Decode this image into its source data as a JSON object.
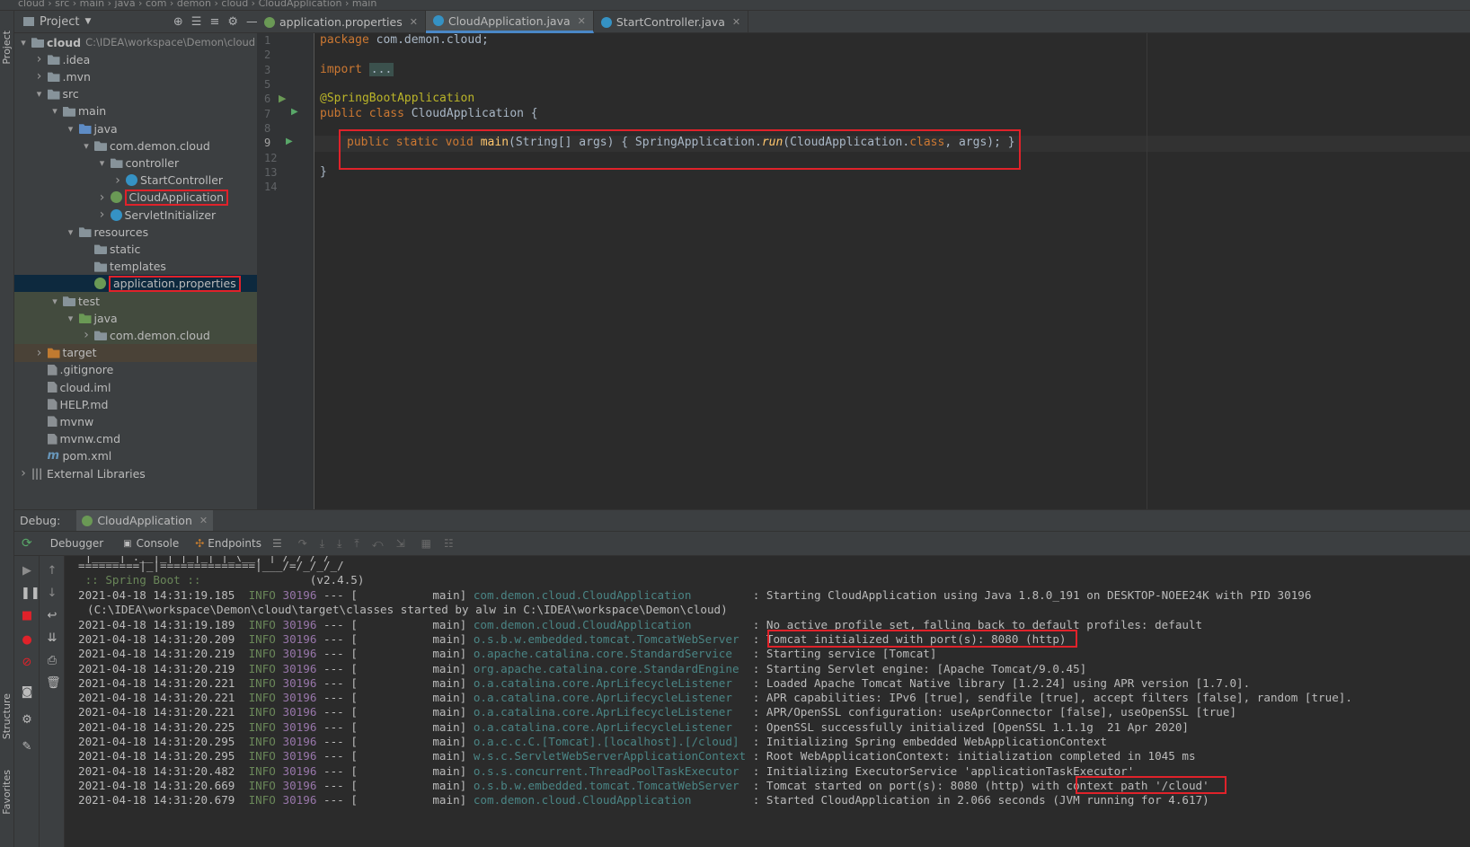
{
  "topbar": {
    "crumb": "cloud › src › main › java › com › demon › cloud › CloudApplication › main"
  },
  "left_stripe": {
    "project": "Project",
    "structure": "Structure",
    "favorites": "Favorites"
  },
  "project_panel": {
    "title": "Project",
    "tree": [
      {
        "label": "cloud",
        "hint": "C:\\IDEA\\workspace\\Demon\\cloud",
        "indent": 0,
        "arrow": "▾",
        "icon": "folder"
      },
      {
        "label": ".idea",
        "indent": 1,
        "arrow": "›",
        "icon": "folder"
      },
      {
        "label": ".mvn",
        "indent": 1,
        "arrow": "›",
        "icon": "folder"
      },
      {
        "label": "src",
        "indent": 1,
        "arrow": "▾",
        "icon": "folder"
      },
      {
        "label": "main",
        "indent": 2,
        "arrow": "▾",
        "icon": "folder"
      },
      {
        "label": "java",
        "indent": 3,
        "arrow": "▾",
        "icon": "folder-blue"
      },
      {
        "label": "com.demon.cloud",
        "indent": 4,
        "arrow": "▾",
        "icon": "folder"
      },
      {
        "label": "controller",
        "indent": 5,
        "arrow": "▾",
        "icon": "folder"
      },
      {
        "label": "StartController",
        "indent": 6,
        "arrow": "›",
        "icon": "class"
      },
      {
        "label": "CloudApplication",
        "indent": 5,
        "arrow": "›",
        "icon": "spring",
        "highlight": true
      },
      {
        "label": "ServletInitializer",
        "indent": 5,
        "arrow": "›",
        "icon": "class"
      },
      {
        "label": "resources",
        "indent": 3,
        "arrow": "▾",
        "icon": "folder"
      },
      {
        "label": "static",
        "indent": 4,
        "arrow": "",
        "icon": "folder"
      },
      {
        "label": "templates",
        "indent": 4,
        "arrow": "",
        "icon": "folder"
      },
      {
        "label": "application.properties",
        "indent": 4,
        "arrow": "",
        "icon": "spring",
        "highlight": true,
        "selected": true
      },
      {
        "label": "test",
        "indent": 2,
        "arrow": "▾",
        "icon": "folder"
      },
      {
        "label": "java",
        "indent": 3,
        "arrow": "▾",
        "icon": "folder-green"
      },
      {
        "label": "com.demon.cloud",
        "indent": 4,
        "arrow": "›",
        "icon": "folder"
      },
      {
        "label": "target",
        "indent": 1,
        "arrow": "›",
        "icon": "folder-orange"
      },
      {
        "label": ".gitignore",
        "indent": 1,
        "arrow": "",
        "icon": "file"
      },
      {
        "label": "cloud.iml",
        "indent": 1,
        "arrow": "",
        "icon": "file"
      },
      {
        "label": "HELP.md",
        "indent": 1,
        "arrow": "",
        "icon": "file"
      },
      {
        "label": "mvnw",
        "indent": 1,
        "arrow": "",
        "icon": "file"
      },
      {
        "label": "mvnw.cmd",
        "indent": 1,
        "arrow": "",
        "icon": "file"
      },
      {
        "label": "pom.xml",
        "indent": 1,
        "arrow": "",
        "icon": "maven"
      },
      {
        "label": "External Libraries",
        "indent": 0,
        "arrow": "›",
        "icon": "lib"
      }
    ]
  },
  "tabs": [
    {
      "label": "application.properties",
      "active": false,
      "icon_color": "#6a9955"
    },
    {
      "label": "CloudApplication.java",
      "active": true,
      "icon_color": "#3592c4"
    },
    {
      "label": "StartController.java",
      "active": false,
      "icon_color": "#3592c4"
    }
  ],
  "editor": {
    "line_numbers": [
      "1",
      "2",
      "3",
      "5",
      "6",
      "7",
      "8",
      "9",
      "12",
      "13",
      "14"
    ],
    "lines": {
      "l1_kw": "package",
      "l1_rest": " com.demon.cloud;",
      "l3_kw": "import",
      "l3_fold": "...",
      "l6": "@SpringBootApplication",
      "l7_kw": "public class",
      "l7_name": " CloudApplication",
      "l7_rest": " {",
      "l9_kw": "public static void",
      "l9_name": " main",
      "l9_params": "(String[] args)",
      "l9_body1": " { SpringApplication.",
      "l9_run": "run",
      "l9_body2": "(CloudApplication.",
      "l9_class": "class",
      "l9_body3": ", args); }",
      "l13": "}"
    }
  },
  "debug": {
    "label": "Debug:",
    "session": "CloudApplication",
    "toolbar": [
      "Debugger",
      "Console",
      "Endpoints"
    ]
  },
  "console": {
    "banner1": "=========|_|==============|___/=/_/_/_/",
    "banner_label": " :: Spring Boot :: ",
    "banner_version": "               (v2.4.5)",
    "wrap_line": "(C:\\IDEA\\workspace\\Demon\\cloud\\target\\classes started by alw in C:\\IDEA\\workspace\\Demon\\cloud)",
    "logs": [
      {
        "ts": "2021-04-18 14:31:19.185",
        "level": "INFO",
        "pid": "30196",
        "thread": "main",
        "logger": "com.demon.cloud.CloudApplication        ",
        "msg": "Starting CloudApplication using Java 1.8.0_191 on DESKTOP-NOEE24K with PID 30196"
      },
      {
        "ts": "2021-04-18 14:31:19.189",
        "level": "INFO",
        "pid": "30196",
        "thread": "main",
        "logger": "com.demon.cloud.CloudApplication        ",
        "msg": "No active profile set, falling back to default profiles: default"
      },
      {
        "ts": "2021-04-18 14:31:20.209",
        "level": "INFO",
        "pid": "30196",
        "thread": "main",
        "logger": "o.s.b.w.embedded.tomcat.TomcatWebServer ",
        "msg": "Tomcat initialized with port(s): 8080 (http)"
      },
      {
        "ts": "2021-04-18 14:31:20.219",
        "level": "INFO",
        "pid": "30196",
        "thread": "main",
        "logger": "o.apache.catalina.core.StandardService  ",
        "msg": "Starting service [Tomcat]"
      },
      {
        "ts": "2021-04-18 14:31:20.219",
        "level": "INFO",
        "pid": "30196",
        "thread": "main",
        "logger": "org.apache.catalina.core.StandardEngine ",
        "msg": "Starting Servlet engine: [Apache Tomcat/9.0.45]"
      },
      {
        "ts": "2021-04-18 14:31:20.221",
        "level": "INFO",
        "pid": "30196",
        "thread": "main",
        "logger": "o.a.catalina.core.AprLifecycleListener  ",
        "msg": "Loaded Apache Tomcat Native library [1.2.24] using APR version [1.7.0]."
      },
      {
        "ts": "2021-04-18 14:31:20.221",
        "level": "INFO",
        "pid": "30196",
        "thread": "main",
        "logger": "o.a.catalina.core.AprLifecycleListener  ",
        "msg": "APR capabilities: IPv6 [true], sendfile [true], accept filters [false], random [true]."
      },
      {
        "ts": "2021-04-18 14:31:20.221",
        "level": "INFO",
        "pid": "30196",
        "thread": "main",
        "logger": "o.a.catalina.core.AprLifecycleListener  ",
        "msg": "APR/OpenSSL configuration: useAprConnector [false], useOpenSSL [true]"
      },
      {
        "ts": "2021-04-18 14:31:20.225",
        "level": "INFO",
        "pid": "30196",
        "thread": "main",
        "logger": "o.a.catalina.core.AprLifecycleListener  ",
        "msg": "OpenSSL successfully initialized [OpenSSL 1.1.1g  21 Apr 2020]"
      },
      {
        "ts": "2021-04-18 14:31:20.295",
        "level": "INFO",
        "pid": "30196",
        "thread": "main",
        "logger": "o.a.c.c.C.[Tomcat].[localhost].[/cloud] ",
        "msg": "Initializing Spring embedded WebApplicationContext"
      },
      {
        "ts": "2021-04-18 14:31:20.295",
        "level": "INFO",
        "pid": "30196",
        "thread": "main",
        "logger": "w.s.c.ServletWebServerApplicationContext",
        "msg": "Root WebApplicationContext: initialization completed in 1045 ms"
      },
      {
        "ts": "2021-04-18 14:31:20.482",
        "level": "INFO",
        "pid": "30196",
        "thread": "main",
        "logger": "o.s.s.concurrent.ThreadPoolTaskExecutor ",
        "msg": "Initializing ExecutorService 'applicationTaskExecutor'"
      },
      {
        "ts": "2021-04-18 14:31:20.669",
        "level": "INFO",
        "pid": "30196",
        "thread": "main",
        "logger": "o.s.b.w.embedded.tomcat.TomcatWebServer ",
        "msg": "Tomcat started on port(s): 8080 (http) with context path '/cloud'"
      },
      {
        "ts": "2021-04-18 14:31:20.679",
        "level": "INFO",
        "pid": "30196",
        "thread": "main",
        "logger": "com.demon.cloud.CloudApplication        ",
        "msg": "Started CloudApplication in 2.066 seconds (JVM running for 4.617)"
      }
    ]
  }
}
